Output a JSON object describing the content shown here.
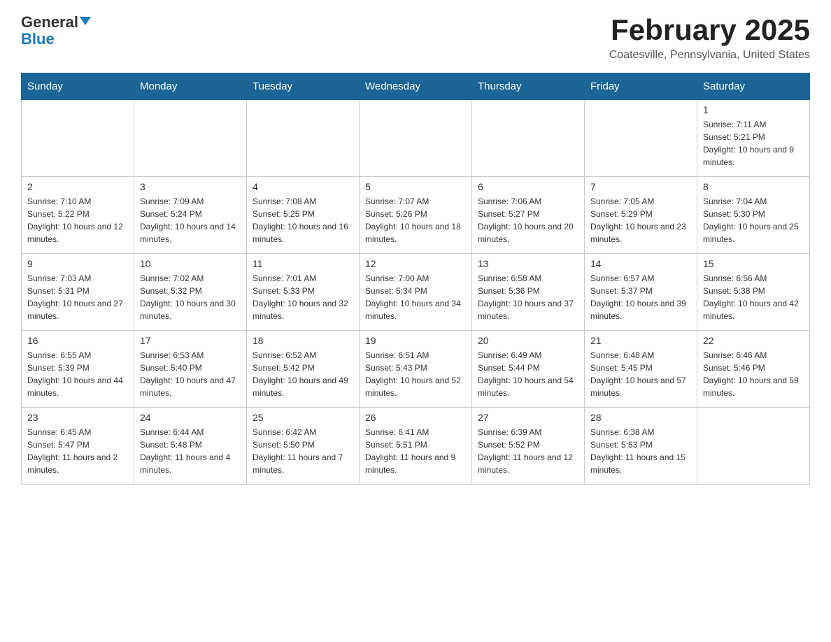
{
  "header": {
    "logo_general": "General",
    "logo_blue": "Blue",
    "month_title": "February 2025",
    "location": "Coatesville, Pennsylvania, United States"
  },
  "days_of_week": [
    "Sunday",
    "Monday",
    "Tuesday",
    "Wednesday",
    "Thursday",
    "Friday",
    "Saturday"
  ],
  "weeks": [
    [
      {
        "day": "",
        "info": ""
      },
      {
        "day": "",
        "info": ""
      },
      {
        "day": "",
        "info": ""
      },
      {
        "day": "",
        "info": ""
      },
      {
        "day": "",
        "info": ""
      },
      {
        "day": "",
        "info": ""
      },
      {
        "day": "1",
        "info": "Sunrise: 7:11 AM\nSunset: 5:21 PM\nDaylight: 10 hours and 9 minutes."
      }
    ],
    [
      {
        "day": "2",
        "info": "Sunrise: 7:10 AM\nSunset: 5:22 PM\nDaylight: 10 hours and 12 minutes."
      },
      {
        "day": "3",
        "info": "Sunrise: 7:09 AM\nSunset: 5:24 PM\nDaylight: 10 hours and 14 minutes."
      },
      {
        "day": "4",
        "info": "Sunrise: 7:08 AM\nSunset: 5:25 PM\nDaylight: 10 hours and 16 minutes."
      },
      {
        "day": "5",
        "info": "Sunrise: 7:07 AM\nSunset: 5:26 PM\nDaylight: 10 hours and 18 minutes."
      },
      {
        "day": "6",
        "info": "Sunrise: 7:06 AM\nSunset: 5:27 PM\nDaylight: 10 hours and 20 minutes."
      },
      {
        "day": "7",
        "info": "Sunrise: 7:05 AM\nSunset: 5:29 PM\nDaylight: 10 hours and 23 minutes."
      },
      {
        "day": "8",
        "info": "Sunrise: 7:04 AM\nSunset: 5:30 PM\nDaylight: 10 hours and 25 minutes."
      }
    ],
    [
      {
        "day": "9",
        "info": "Sunrise: 7:03 AM\nSunset: 5:31 PM\nDaylight: 10 hours and 27 minutes."
      },
      {
        "day": "10",
        "info": "Sunrise: 7:02 AM\nSunset: 5:32 PM\nDaylight: 10 hours and 30 minutes."
      },
      {
        "day": "11",
        "info": "Sunrise: 7:01 AM\nSunset: 5:33 PM\nDaylight: 10 hours and 32 minutes."
      },
      {
        "day": "12",
        "info": "Sunrise: 7:00 AM\nSunset: 5:34 PM\nDaylight: 10 hours and 34 minutes."
      },
      {
        "day": "13",
        "info": "Sunrise: 6:58 AM\nSunset: 5:36 PM\nDaylight: 10 hours and 37 minutes."
      },
      {
        "day": "14",
        "info": "Sunrise: 6:57 AM\nSunset: 5:37 PM\nDaylight: 10 hours and 39 minutes."
      },
      {
        "day": "15",
        "info": "Sunrise: 6:56 AM\nSunset: 5:38 PM\nDaylight: 10 hours and 42 minutes."
      }
    ],
    [
      {
        "day": "16",
        "info": "Sunrise: 6:55 AM\nSunset: 5:39 PM\nDaylight: 10 hours and 44 minutes."
      },
      {
        "day": "17",
        "info": "Sunrise: 6:53 AM\nSunset: 5:40 PM\nDaylight: 10 hours and 47 minutes."
      },
      {
        "day": "18",
        "info": "Sunrise: 6:52 AM\nSunset: 5:42 PM\nDaylight: 10 hours and 49 minutes."
      },
      {
        "day": "19",
        "info": "Sunrise: 6:51 AM\nSunset: 5:43 PM\nDaylight: 10 hours and 52 minutes."
      },
      {
        "day": "20",
        "info": "Sunrise: 6:49 AM\nSunset: 5:44 PM\nDaylight: 10 hours and 54 minutes."
      },
      {
        "day": "21",
        "info": "Sunrise: 6:48 AM\nSunset: 5:45 PM\nDaylight: 10 hours and 57 minutes."
      },
      {
        "day": "22",
        "info": "Sunrise: 6:46 AM\nSunset: 5:46 PM\nDaylight: 10 hours and 59 minutes."
      }
    ],
    [
      {
        "day": "23",
        "info": "Sunrise: 6:45 AM\nSunset: 5:47 PM\nDaylight: 11 hours and 2 minutes."
      },
      {
        "day": "24",
        "info": "Sunrise: 6:44 AM\nSunset: 5:48 PM\nDaylight: 11 hours and 4 minutes."
      },
      {
        "day": "25",
        "info": "Sunrise: 6:42 AM\nSunset: 5:50 PM\nDaylight: 11 hours and 7 minutes."
      },
      {
        "day": "26",
        "info": "Sunrise: 6:41 AM\nSunset: 5:51 PM\nDaylight: 11 hours and 9 minutes."
      },
      {
        "day": "27",
        "info": "Sunrise: 6:39 AM\nSunset: 5:52 PM\nDaylight: 11 hours and 12 minutes."
      },
      {
        "day": "28",
        "info": "Sunrise: 6:38 AM\nSunset: 5:53 PM\nDaylight: 11 hours and 15 minutes."
      },
      {
        "day": "",
        "info": ""
      }
    ]
  ]
}
